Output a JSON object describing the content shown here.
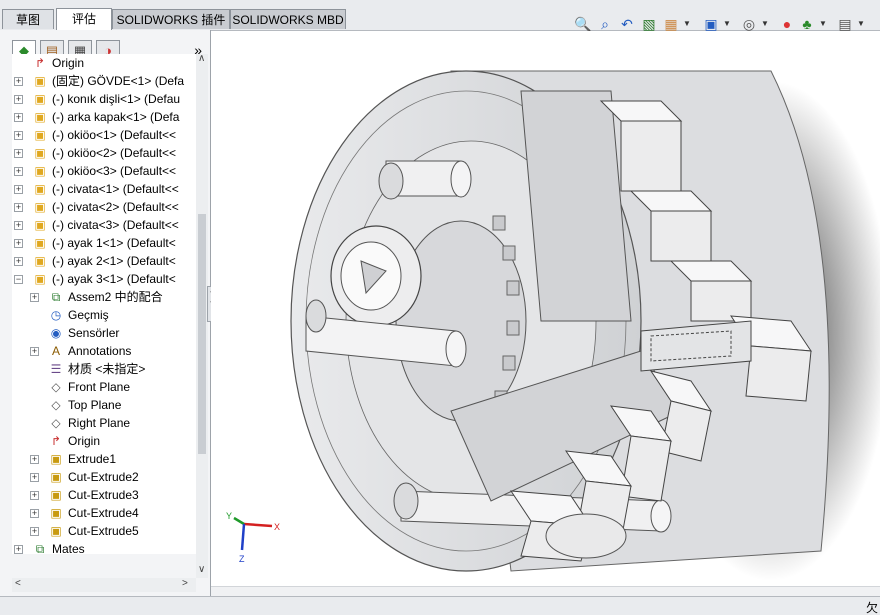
{
  "tabs": [
    {
      "label": "草图"
    },
    {
      "label": "评估"
    },
    {
      "label": "SOLIDWORKS 插件"
    },
    {
      "label": "SOLIDWORKS MBD"
    }
  ],
  "toolbar": {
    "icons": [
      "zoom-to-fit-icon",
      "zoom-area-icon",
      "previous-view-icon",
      "section-view-icon",
      "dynamic-annotation-icon",
      "view-orientation-icon",
      "display-style-icon",
      "hide-show-icon",
      "edit-appearance-icon",
      "apply-scene-icon",
      "view-settings-icon"
    ]
  },
  "panel": {
    "expand_label": "»",
    "tabs": [
      "feature-manager-icon",
      "property-manager-icon",
      "configuration-manager-icon",
      "display-manager-icon"
    ]
  },
  "tree": {
    "items": [
      {
        "label": "Origin",
        "icon": "origin-icon"
      },
      {
        "label": "(固定) GÖVDE<1> (Defa",
        "icon": "part-icon"
      },
      {
        "label": "(-) konık dişli<1> (Defau",
        "icon": "part-icon"
      },
      {
        "label": "(-) arka kapak<1> (Defa",
        "icon": "part-icon"
      },
      {
        "label": "(-) okiöo<1> (Default<<",
        "icon": "part-icon"
      },
      {
        "label": "(-) okiöo<2> (Default<<",
        "icon": "part-icon"
      },
      {
        "label": "(-) okiöo<3> (Default<<",
        "icon": "part-icon"
      },
      {
        "label": "(-) civata<1> (Default<<",
        "icon": "part-icon"
      },
      {
        "label": "(-) civata<2> (Default<<",
        "icon": "part-icon"
      },
      {
        "label": "(-) civata<3> (Default<<",
        "icon": "part-icon"
      },
      {
        "label": "(-) ayak 1<1> (Default<",
        "icon": "part-icon"
      },
      {
        "label": "(-) ayak 2<1> (Default<",
        "icon": "part-icon"
      },
      {
        "label": "(-) ayak 3<1> (Default<",
        "icon": "part-icon"
      },
      {
        "label": "Assem2 中的配合",
        "icon": "mates-icon"
      },
      {
        "label": "Geçmiş",
        "icon": "history-icon"
      },
      {
        "label": "Sensörler",
        "icon": "sensors-icon"
      },
      {
        "label": "Annotations",
        "icon": "annotations-icon"
      },
      {
        "label": "材质 <未指定>",
        "icon": "material-icon"
      },
      {
        "label": "Front Plane",
        "icon": "plane-icon"
      },
      {
        "label": "Top Plane",
        "icon": "plane-icon"
      },
      {
        "label": "Right Plane",
        "icon": "plane-icon"
      },
      {
        "label": "Origin",
        "icon": "origin-icon"
      },
      {
        "label": "Extrude1",
        "icon": "extrude-icon"
      },
      {
        "label": "Cut-Extrude2",
        "icon": "cut-extrude-icon"
      },
      {
        "label": "Cut-Extrude3",
        "icon": "cut-extrude-icon"
      },
      {
        "label": "Cut-Extrude4",
        "icon": "cut-extrude-icon"
      },
      {
        "label": "Cut-Extrude5",
        "icon": "cut-extrude-icon"
      },
      {
        "label": "Mates",
        "icon": "mates-folder-icon"
      }
    ]
  },
  "triad": {
    "x": "X",
    "y": "Y",
    "z": "Z"
  },
  "status": {
    "right": "欠"
  },
  "colors": {
    "accent": "#245dc1",
    "part_yellow": "#f2c12e",
    "x_axis": "#d42020",
    "y_axis": "#1f9a2a",
    "z_axis": "#2040c8"
  }
}
